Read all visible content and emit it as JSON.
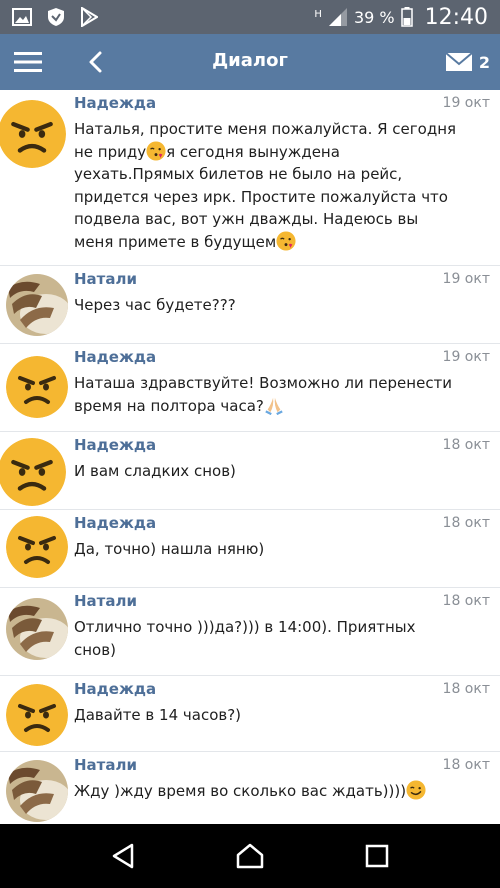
{
  "status_bar": {
    "network_letter": "H",
    "battery": "39 %",
    "time": "12:40"
  },
  "header": {
    "title": "Диалог",
    "mail_count": "2"
  },
  "icons": {
    "menu": "hamburger-menu-icon",
    "back": "back-arrow-icon",
    "mail": "envelope-icon",
    "nav_back": "triangle-back-icon",
    "nav_home": "home-icon",
    "nav_recents": "square-recents-icon"
  },
  "colors": {
    "header_bg": "#587aa1",
    "status_bg": "#5c6470",
    "name_color": "#4e6f98",
    "date_color": "#8a8f96",
    "emoji_yellow": "#f5b731"
  },
  "messages": [
    {
      "name": "Надежда",
      "date": "19 окт",
      "lines": [
        "Наталья, простите меня пожалуйста. Я сегодня",
        "не приду",
        "я сегодня вынуждена",
        "уехать.Прямых билетов не было на рейс,",
        "придется через ирк. Простите пожалуйста что",
        "подвела вас, вот ужн дважды. Надеюсь вы",
        "меня примете в будущем"
      ]
    },
    {
      "name": "Натали",
      "date": "19 окт",
      "text": "Через час будете???"
    },
    {
      "name": "Надежда",
      "date": "19 окт",
      "lines": [
        "Наташа здравствуйте! Возможно ли перенести",
        "время на полтора часа?"
      ]
    },
    {
      "name": "Надежда",
      "date": "18 окт",
      "text": "И вам сладких снов)"
    },
    {
      "name": "Надежда",
      "date": "18 окт",
      "text": "Да, точно) нашла няню)"
    },
    {
      "name": "Натали",
      "date": "18 окт",
      "lines": [
        "Отлично точно )))да?))) в 14:00). Приятных",
        "снов)"
      ]
    },
    {
      "name": "Надежда",
      "date": "18 окт",
      "text": "Давайте в 14 часов?)"
    },
    {
      "name": "Натали",
      "date": "18 окт",
      "text": "Жду )жду время во сколько вас ждать))))"
    }
  ]
}
